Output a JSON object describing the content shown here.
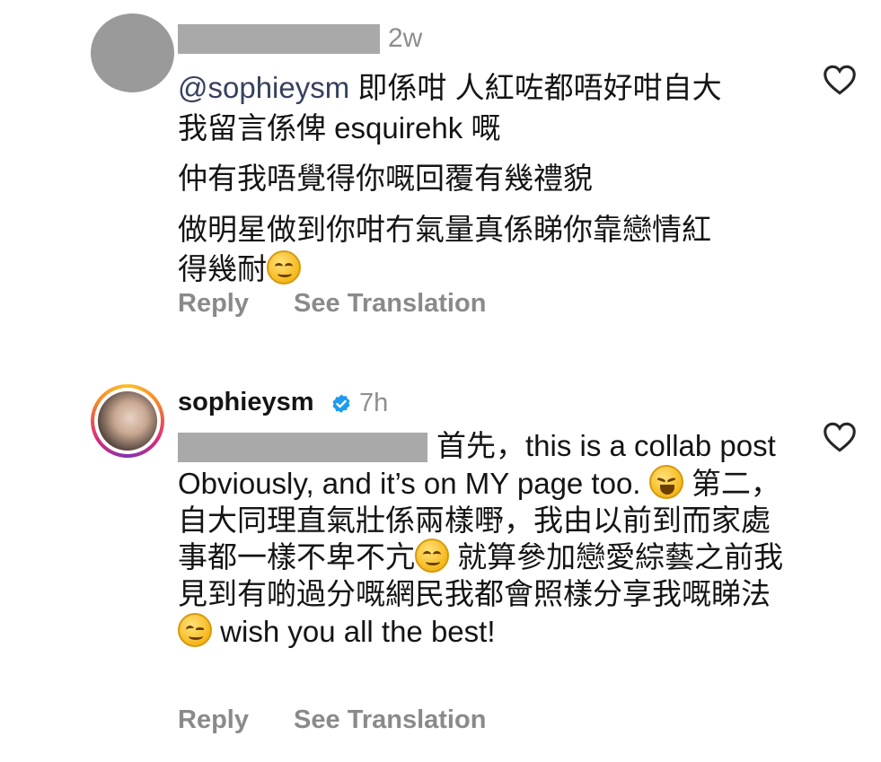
{
  "comment1": {
    "time": "2w",
    "mention": "@sophieysm",
    "line1_rest": " 即係咁 人紅咗都唔好咁自大",
    "line2": "我留言係俾 esquirehk 嘅",
    "line3": "仲有我唔覺得你嘅回覆有幾禮貌",
    "line4": "做明星做到你咁冇氣量真係睇你靠戀情紅",
    "line5": "得幾耐",
    "reply_label": "Reply",
    "translate_label": "See Translation"
  },
  "comment2": {
    "username": "sophieysm",
    "time": "7h",
    "seg1": "首先，this is a collab post Obviously, and it’s on MY page too. ",
    "seg2": " 第二，自大同理直氣壯係兩樣嘢，我由以前到而家處事都一樣不卑不亢",
    "seg3": " 就算參加戀愛綜藝之前我見到有啲過分嘅網民我都會照樣分享我嘅睇法",
    "seg4": " wish you all the best!",
    "reply_label": "Reply",
    "translate_label": "See Translation"
  },
  "icons": {
    "heart": "heart-outline-icon",
    "verified": "verified-badge-icon",
    "emoji_smile": "smiling-face-emoji",
    "emoji_squint": "grinning-squinting-face-emoji",
    "emoji_wink": "winking-face-emoji"
  },
  "colors": {
    "mention": "#37415f",
    "muted": "#8e8e8e",
    "verified": "#1d9bf0",
    "redaction": "#a9a9a9"
  }
}
